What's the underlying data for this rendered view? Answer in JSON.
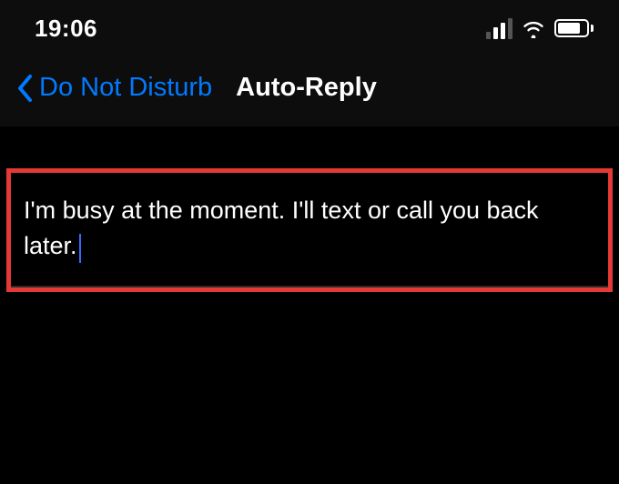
{
  "statusBar": {
    "time": "19:06"
  },
  "nav": {
    "backLabel": "Do Not Disturb",
    "title": "Auto-Reply"
  },
  "autoReply": {
    "message": "I'm busy at the moment. I'll text or call you back later."
  }
}
